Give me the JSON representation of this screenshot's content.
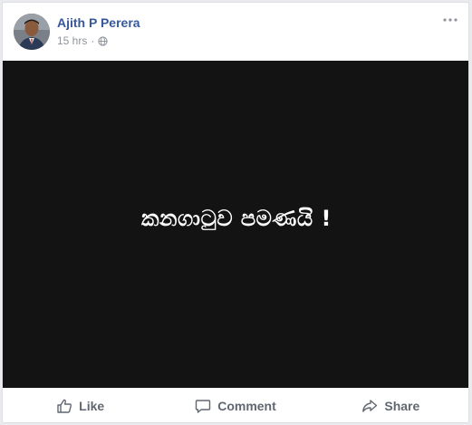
{
  "post": {
    "author": "Ajith P Perera",
    "time": "15 hrs",
    "separator": "·",
    "privacy_icon": "globe-icon",
    "menu_icon": "more-options-icon",
    "media_text": "කනගාටුව පමණයි !",
    "media_background": "#131313"
  },
  "actions": {
    "like": "Like",
    "comment": "Comment",
    "share": "Share"
  },
  "colors": {
    "author_link": "#365899",
    "meta_text": "#90949c",
    "action_text": "#616770"
  }
}
